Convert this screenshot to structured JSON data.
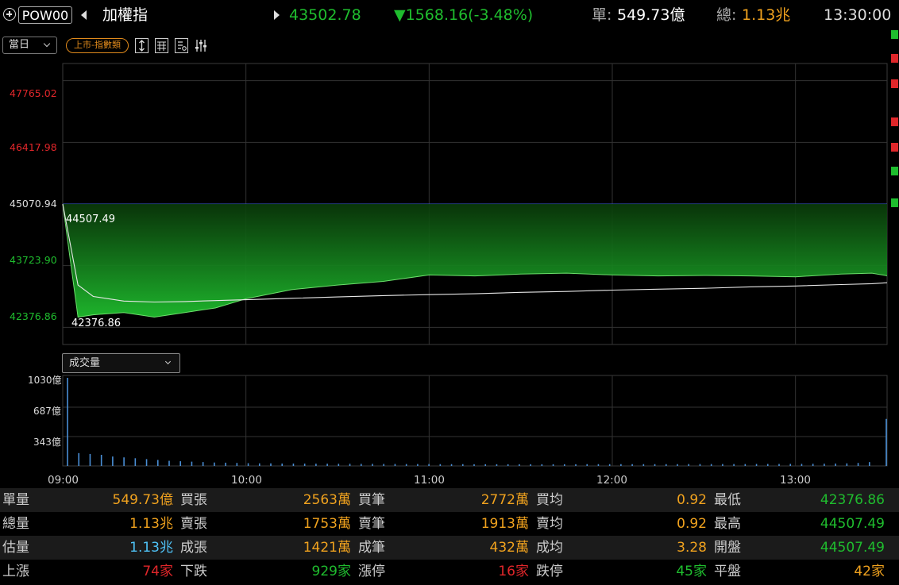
{
  "header": {
    "code": "POW00",
    "name": "加權指",
    "price": "43502.78",
    "change": "▼1568.16(-3.48%)",
    "single_label": "單:",
    "single_value": "549.73億",
    "total_label": "總:",
    "total_value": "1.13兆",
    "time": "13:30:00"
  },
  "toolbar": {
    "period": "當日",
    "market_tag": "上市-指數類",
    "icons": [
      "expand-vertical-icon",
      "calendar-grid-icon",
      "settings-doc-icon",
      "sliders-icon"
    ]
  },
  "colors": {
    "up": "#e0262a",
    "down": "#1fbd2e",
    "accent": "#f0a21e",
    "line": "#2a7b2a"
  },
  "price_chart": {
    "y_ticks": [
      "47765.02",
      "46417.98",
      "45070.94",
      "43723.90",
      "42376.86"
    ],
    "high_label": "44507.49",
    "low_label": "42376.86"
  },
  "volume_chart": {
    "selector": "成交量",
    "y_ticks": [
      "1030億",
      "687億",
      "343億"
    ],
    "x_ticks": [
      "09:00",
      "10:00",
      "11:00",
      "12:00",
      "13:00"
    ]
  },
  "chart_data": {
    "type": "area",
    "title": "",
    "xlabel": "",
    "ylabel": "",
    "x_range": [
      "09:00",
      "13:30"
    ],
    "ylim": [
      42001.55,
      48140.33
    ],
    "reference_line": 45070.94,
    "x": [
      "09:00",
      "09:05",
      "09:10",
      "09:20",
      "09:30",
      "09:40",
      "09:50",
      "10:00",
      "10:15",
      "10:30",
      "10:45",
      "11:00",
      "11:15",
      "11:30",
      "11:45",
      "12:00",
      "12:15",
      "12:30",
      "12:45",
      "13:00",
      "13:15",
      "13:25",
      "13:30"
    ],
    "series": [
      {
        "values": [
          45070.94,
          42600,
          42650,
          42700,
          42600,
          42700,
          42800,
          43000,
          43200,
          43300,
          43380,
          43520,
          43500,
          43540,
          43560,
          43520,
          43500,
          43510,
          43500,
          43480,
          43540,
          43560,
          43502.78
        ]
      },
      {
        "values": [
          45070.94,
          43300,
          43050,
          42950,
          42930,
          42940,
          42960,
          42980,
          43010,
          43040,
          43070,
          43090,
          43110,
          43140,
          43160,
          43190,
          43210,
          43230,
          43260,
          43280,
          43310,
          43330,
          43350
        ]
      }
    ],
    "volume": {
      "unit": "億",
      "ylim": [
        0,
        1030
      ],
      "values": [
        1030,
        150,
        140,
        130,
        110,
        100,
        90,
        80,
        70,
        60,
        55,
        50,
        45,
        40,
        38,
        35,
        32,
        30,
        30,
        28,
        28,
        27,
        26,
        26,
        25,
        25,
        24,
        24,
        23,
        23,
        22,
        22,
        22,
        21,
        21,
        21,
        20,
        20,
        20,
        20,
        20,
        20,
        20,
        20,
        20,
        20,
        21,
        21,
        21,
        21,
        21,
        21,
        21,
        21,
        21,
        22,
        22,
        22,
        22,
        22,
        22,
        23,
        23,
        23,
        24,
        24,
        25,
        26,
        28,
        30,
        35,
        45,
        549.73
      ]
    }
  },
  "stats": {
    "rows": [
      [
        {
          "label": "單量",
          "value": "549.73億",
          "color": "#f0a21e"
        },
        {
          "label": "買張",
          "value": "2563萬",
          "color": "#f0a21e"
        },
        {
          "label": "買筆",
          "value": "2772萬",
          "color": "#f0a21e"
        },
        {
          "label": "買均",
          "value": "0.92",
          "color": "#f0a21e"
        },
        {
          "label": "最低",
          "value": "42376.86",
          "color": "#1fbd2e"
        }
      ],
      [
        {
          "label": "總量",
          "value": "1.13兆",
          "color": "#f0a21e"
        },
        {
          "label": "賣張",
          "value": "1753萬",
          "color": "#f0a21e"
        },
        {
          "label": "賣筆",
          "value": "1913萬",
          "color": "#f0a21e"
        },
        {
          "label": "賣均",
          "value": "0.92",
          "color": "#f0a21e"
        },
        {
          "label": "最高",
          "value": "44507.49",
          "color": "#1fbd2e"
        }
      ],
      [
        {
          "label": "估量",
          "value": "1.13兆",
          "color": "#4fc3f7"
        },
        {
          "label": "成張",
          "value": "1421萬",
          "color": "#f0a21e"
        },
        {
          "label": "成筆",
          "value": "432萬",
          "color": "#f0a21e"
        },
        {
          "label": "成均",
          "value": "3.28",
          "color": "#f0a21e"
        },
        {
          "label": "開盤",
          "value": "44507.49",
          "color": "#1fbd2e"
        }
      ],
      [
        {
          "label": "上漲",
          "value": "74家",
          "color": "#e0262a"
        },
        {
          "label": "下跌",
          "value": "929家",
          "color": "#1fbd2e"
        },
        {
          "label": "漲停",
          "value": "16家",
          "color": "#e0262a"
        },
        {
          "label": "跌停",
          "value": "45家",
          "color": "#1fbd2e"
        },
        {
          "label": "平盤",
          "value": "42家",
          "color": "#f0a21e"
        }
      ]
    ]
  }
}
